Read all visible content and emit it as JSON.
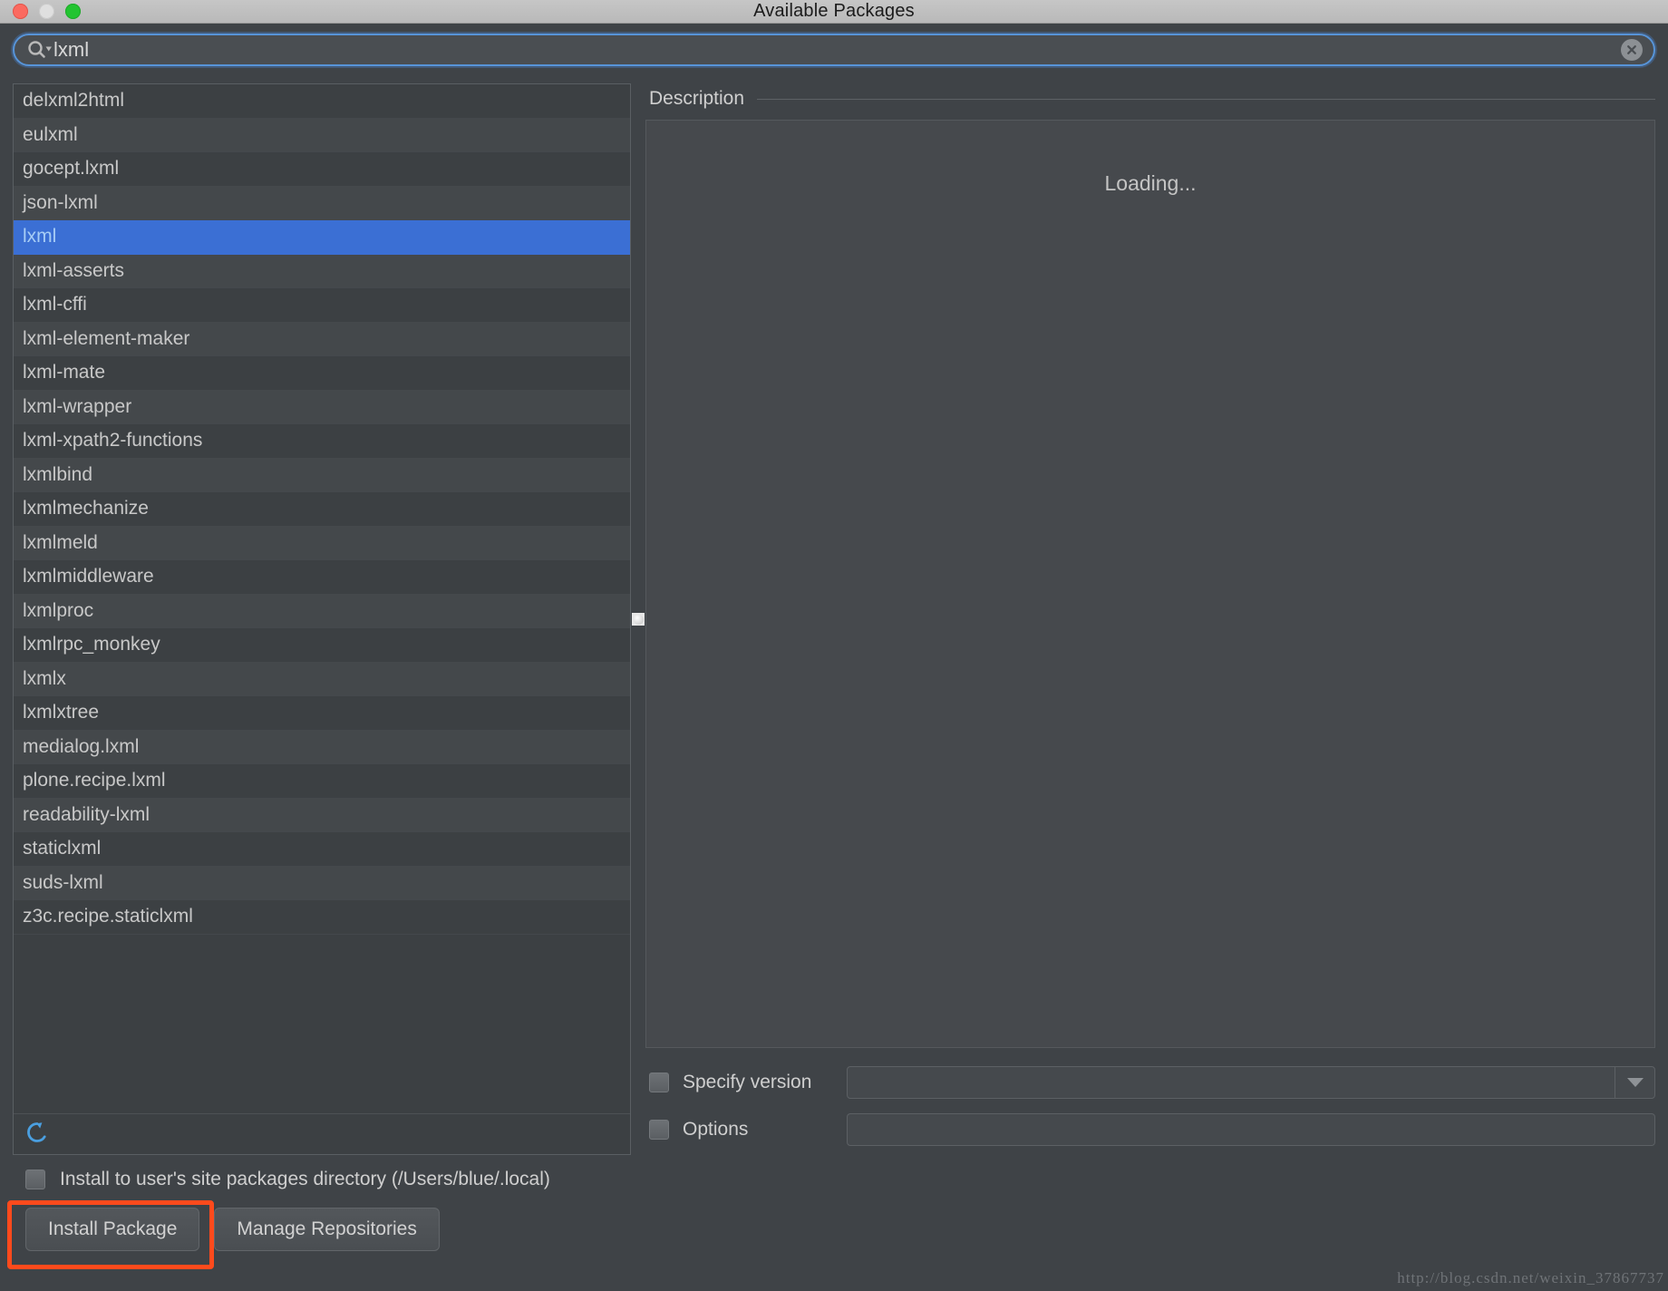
{
  "window": {
    "title": "Available Packages",
    "controls": [
      "close-button",
      "minimize-button",
      "zoom-button"
    ]
  },
  "search": {
    "icon": "search-icon",
    "value": "lxml",
    "placeholder": "",
    "clear_icon": "clear-circle-icon"
  },
  "packages": {
    "selected": "lxml",
    "items": [
      "delxml2html",
      "eulxml",
      "gocept.lxml",
      "json-lxml",
      "lxml",
      "lxml-asserts",
      "lxml-cffi",
      "lxml-element-maker",
      "lxml-mate",
      "lxml-wrapper",
      "lxml-xpath2-functions",
      "lxmlbind",
      "lxmlmechanize",
      "lxmlmeld",
      "lxmlmiddleware",
      "lxmlproc",
      "lxmlrpc_monkey",
      "lxmlx",
      "lxmlxtree",
      "medialog.lxml",
      "plone.recipe.lxml",
      "readability-lxml",
      "staticlxml",
      "suds-lxml",
      "z3c.recipe.staticlxml"
    ],
    "refresh_icon": "refresh-icon"
  },
  "description": {
    "label": "Description",
    "content": "Loading..."
  },
  "options": {
    "specify_version": {
      "label": "Specify version",
      "checked": false,
      "value": "",
      "dropdown_icon": "chevron-down-icon"
    },
    "options_field": {
      "label": "Options",
      "checked": false,
      "value": ""
    }
  },
  "footer": {
    "user_site_label": "Install to user's site packages directory (/Users/blue/.local)",
    "user_site_checked": false,
    "install_button": "Install Package",
    "manage_button": "Manage Repositories",
    "highlight_color": "#ff4a1c"
  },
  "watermark": "http://blog.csdn.net/weixin_37867737",
  "colors": {
    "selection_blue": "#3b6fd4",
    "selection_text": "#a7cdf5",
    "accent_focus": "#5794d8",
    "refresh_icon": "#4a9fe0",
    "window_bg": "#3f4347"
  }
}
